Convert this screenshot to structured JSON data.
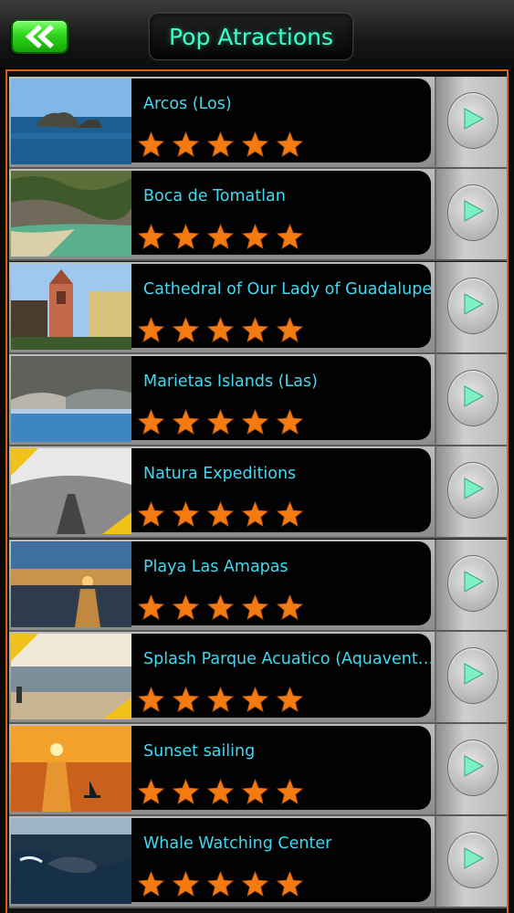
{
  "header": {
    "title": "Pop Atractions",
    "back_icon": "double-chevron-left-icon",
    "back_color": "#2fd61c",
    "title_color": "#3dffc8"
  },
  "colors": {
    "frame_border": "#d9621c",
    "star": "#f47a12",
    "name_text": "#3fd9f2"
  },
  "items": [
    {
      "name": "Arcos (Los)",
      "rating": 5,
      "thumb": "rock-islands-sea"
    },
    {
      "name": "Boca de Tomatlan",
      "rating": 5,
      "thumb": "rocky-beach"
    },
    {
      "name": "Cathedral of Our Lady of Guadalupe",
      "rating": 5,
      "thumb": "cathedral-tower"
    },
    {
      "name": "Marietas Islands (Las)",
      "rating": 5,
      "thumb": "island-cliffs"
    },
    {
      "name": "Natura Expeditions",
      "rating": 5,
      "thumb": "tunnel-walkway"
    },
    {
      "name": "Playa Las Amapas",
      "rating": 5,
      "thumb": "beach-sunset"
    },
    {
      "name": "Splash Parque Acuatico (Aquaventura...",
      "rating": 5,
      "thumb": "beach-people"
    },
    {
      "name": "Sunset sailing",
      "rating": 5,
      "thumb": "sunset-sailboat"
    },
    {
      "name": "Whale Watching Center",
      "rating": 5,
      "thumb": "whale-ocean"
    }
  ]
}
